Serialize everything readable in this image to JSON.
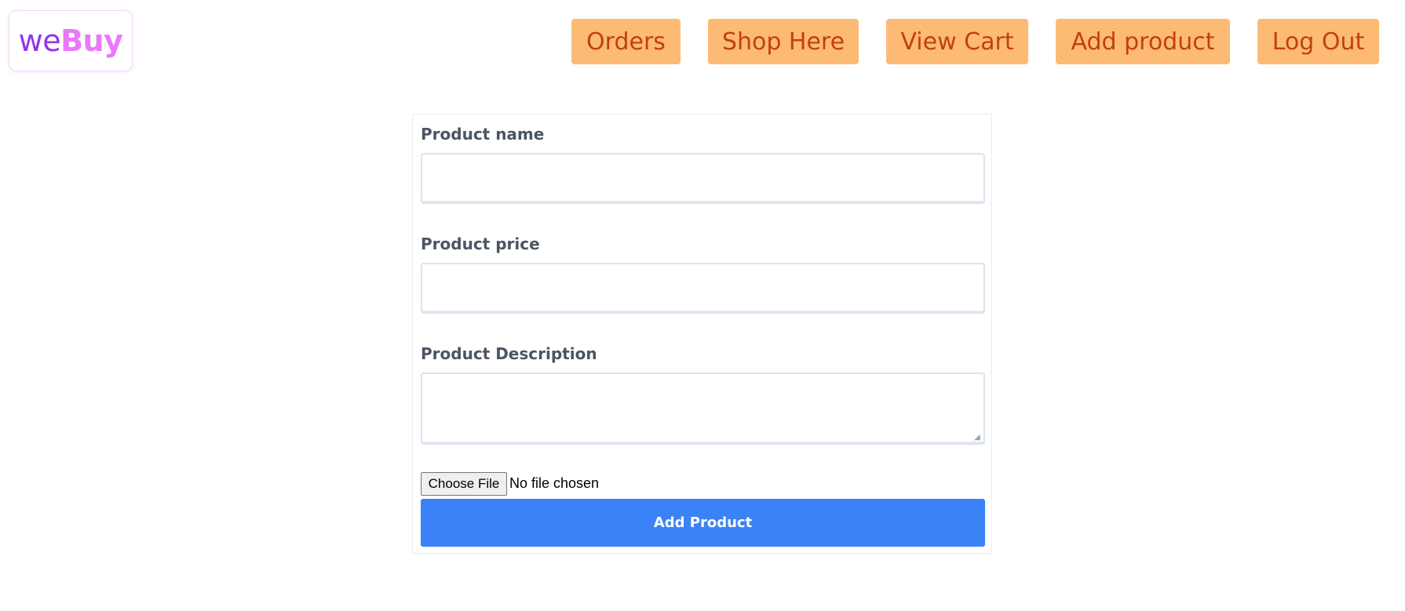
{
  "header": {
    "logo": {
      "part1": "we",
      "part2": "Buy"
    },
    "nav": [
      {
        "label": "Orders"
      },
      {
        "label": "Shop Here"
      },
      {
        "label": "View Cart"
      },
      {
        "label": "Add product"
      },
      {
        "label": "Log Out"
      }
    ]
  },
  "form": {
    "product_name": {
      "label": "Product name",
      "value": ""
    },
    "product_price": {
      "label": "Product price",
      "value": ""
    },
    "product_description": {
      "label": "Product Description",
      "value": ""
    },
    "file": {
      "button_label": "Choose File",
      "status": "No file chosen"
    },
    "submit_label": "Add Product"
  },
  "colors": {
    "nav_bg": "#fdba74",
    "nav_text": "#c2410c",
    "logo_we": "#9333ea",
    "logo_buy": "#e879f9",
    "submit_bg": "#3b82f6"
  }
}
